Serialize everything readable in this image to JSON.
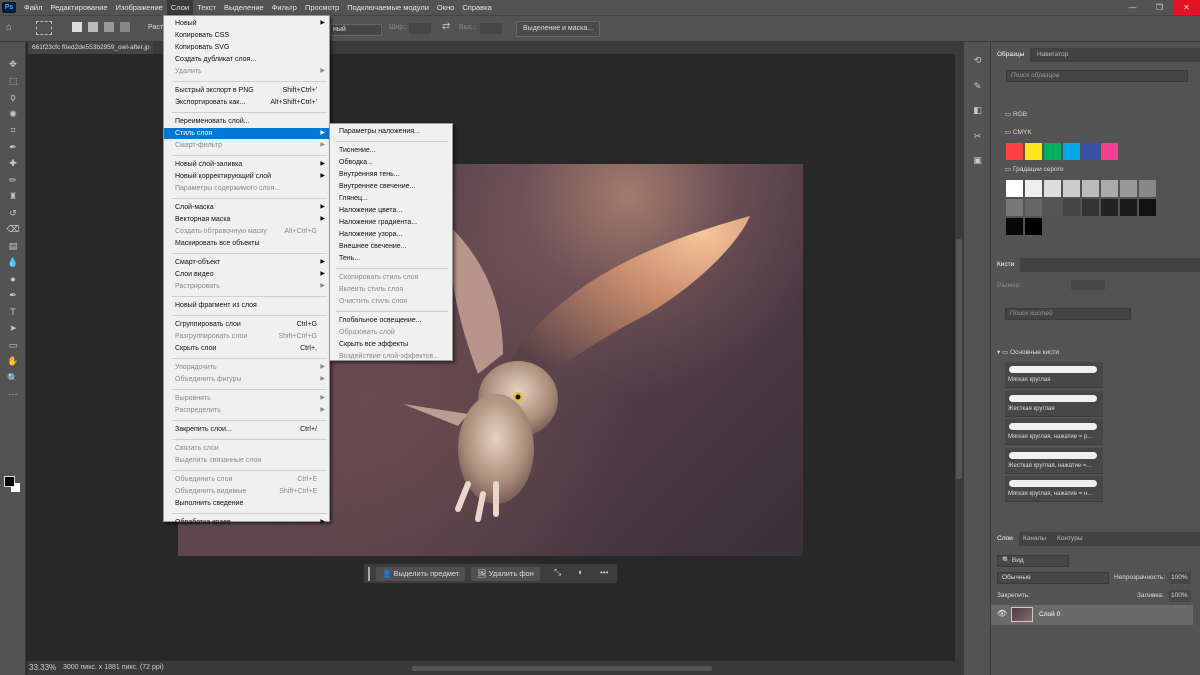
{
  "menubar": {
    "logo": "Ps",
    "items": [
      "Файл",
      "Редактирование",
      "Изображение",
      "Слои",
      "Текст",
      "Выделение",
      "Фильтр",
      "Просмотр",
      "Подключаемые модули",
      "Окно",
      "Справка"
    ]
  },
  "window_controls": {
    "minimize": "—",
    "maximize": "❐",
    "close": "✕"
  },
  "optionsbar": {
    "style_label": "Раст",
    "style_value": "ный",
    "width_label": "Шир.:",
    "height_label": "Выс.:",
    "select_mask_button": "Выделение и маска..."
  },
  "document_tab": {
    "title": "661f23cfc f0ed2de553b2959_owl-after.jp"
  },
  "layer_menu": [
    {
      "label": "Новый",
      "arrow": true
    },
    {
      "label": "Копировать CSS"
    },
    {
      "label": "Копировать SVG"
    },
    {
      "label": "Создать дубликат слоя..."
    },
    {
      "label": "Удалить",
      "arrow": true,
      "disabled": true
    },
    {
      "label": "Быстрый экспорт в PNG",
      "shortcut": "Shift+Ctrl+'"
    },
    {
      "label": "Экспортировать как...",
      "shortcut": "Alt+Shift+Ctrl+'"
    },
    {
      "label": "Переименовать слой..."
    },
    {
      "label": "Стиль слоя",
      "arrow": true,
      "highlighted": true
    },
    {
      "label": "Смарт-фильтр",
      "arrow": true,
      "disabled": true
    },
    {
      "label": "Новый слой-заливка",
      "arrow": true
    },
    {
      "label": "Новый корректирующий слой",
      "arrow": true
    },
    {
      "label": "Параметры содержимого слоя...",
      "disabled": true
    },
    {
      "label": "Слой-маска",
      "arrow": true
    },
    {
      "label": "Векторная маска",
      "arrow": true
    },
    {
      "label": "Создать обтравочную маску",
      "shortcut": "Alt+Ctrl+G",
      "disabled": true
    },
    {
      "label": "Маскировать все объекты"
    },
    {
      "label": "Смарт-объект",
      "arrow": true
    },
    {
      "label": "Слои видео",
      "arrow": true
    },
    {
      "label": "Растрировать",
      "arrow": true,
      "disabled": true
    },
    {
      "label": "Новый фрагмент из слоя"
    },
    {
      "label": "Сгруппировать слои",
      "shortcut": "Ctrl+G"
    },
    {
      "label": "Разгруппировать слои",
      "shortcut": "Shift+Ctrl+G",
      "disabled": true
    },
    {
      "label": "Скрыть слои",
      "shortcut": "Ctrl+,"
    },
    {
      "label": "Упорядочить",
      "arrow": true,
      "disabled": true
    },
    {
      "label": "Объединить фигуры",
      "arrow": true,
      "disabled": true
    },
    {
      "label": "Выровнять",
      "arrow": true,
      "disabled": true
    },
    {
      "label": "Распределить",
      "arrow": true,
      "disabled": true
    },
    {
      "label": "Закрепить слои...",
      "shortcut": "Ctrl+/"
    },
    {
      "label": "Связать слои",
      "disabled": true
    },
    {
      "label": "Выделить связанные слои",
      "disabled": true
    },
    {
      "label": "Объединить слои",
      "shortcut": "Ctrl+E",
      "disabled": true
    },
    {
      "label": "Объединить видимые",
      "shortcut": "Shift+Ctrl+E",
      "disabled": true
    },
    {
      "label": "Выполнить сведение"
    },
    {
      "label": "Обработка краев",
      "arrow": true
    }
  ],
  "layer_style_submenu": [
    {
      "label": "Параметры наложения..."
    },
    {
      "label": "Тиснение..."
    },
    {
      "label": "Обводка..."
    },
    {
      "label": "Внутренняя тень..."
    },
    {
      "label": "Внутреннее свечение..."
    },
    {
      "label": "Глянец..."
    },
    {
      "label": "Наложение цвета..."
    },
    {
      "label": "Наложение градиента..."
    },
    {
      "label": "Наложение узора..."
    },
    {
      "label": "Внешнее свечение..."
    },
    {
      "label": "Тень..."
    },
    {
      "label": "Скопировать стиль слоя",
      "disabled": true
    },
    {
      "label": "Вклеить стиль слоя",
      "disabled": true
    },
    {
      "label": "Очистить стиль слоя",
      "disabled": true
    },
    {
      "label": "Глобальное освещение..."
    },
    {
      "label": "Образовать слой",
      "disabled": true
    },
    {
      "label": "Скрыть все эффекты"
    },
    {
      "label": "Воздействие слой-эффектов...",
      "disabled": true
    }
  ],
  "context_bar": {
    "select_subject": "Выделить предмет",
    "remove_bg": "Удалить фон",
    "more": "•••"
  },
  "status": {
    "zoom": "33.33%",
    "info": "3000 пикс. x 1881 пикс. (72 ppi)"
  },
  "swatches_panel": {
    "tabs": [
      "Образцы",
      "Навигатор"
    ],
    "search_placeholder": "Поиск образцов",
    "groups": [
      "RGB",
      "CMYK",
      "Градации серого"
    ],
    "cmyk_colors": [
      "#ff4040",
      "#ffe31a",
      "#00b060",
      "#00a8e8",
      "#3c50a8",
      "#f04090"
    ],
    "gray_row1": [
      "#ffffff",
      "#eeeeee",
      "#dddddd",
      "#cccccc",
      "#bbbbbb",
      "#aaaaaa",
      "#999999",
      "#888888"
    ],
    "gray_row2": [
      "#777777",
      "#666666",
      "#555555",
      "#444444",
      "#333333",
      "#222222",
      "#1a1a1a",
      "#111111"
    ],
    "gray_row3": [
      "#080808",
      "#000000"
    ]
  },
  "brushes_panel": {
    "tab": "Кисти",
    "size_label": "Размер:",
    "search_placeholder": "Поиск кистей",
    "group": "Основные кисти",
    "brushes": [
      "Мягкая круглая",
      "Жесткая круглая",
      "Мягкая круглая, нажатие = р...",
      "Жесткая круглая, нажатие =...",
      "Мягкая круглая, нажатие = н..."
    ]
  },
  "layers_panel": {
    "tabs": [
      "Слои",
      "Каналы",
      "Контуры"
    ],
    "filter": "Вид",
    "blend_mode": "Обычные",
    "opacity_label": "Непрозрачность:",
    "opacity_value": "100%",
    "lock_label": "Закрепить:",
    "fill_label": "Заливка:",
    "fill_value": "100%",
    "layer_name": "Слой 0",
    "footer_icons": [
      "link-icon",
      "fx-icon",
      "mask-icon",
      "adjustment-icon",
      "folder-icon",
      "new-layer-icon",
      "trash-icon"
    ]
  }
}
